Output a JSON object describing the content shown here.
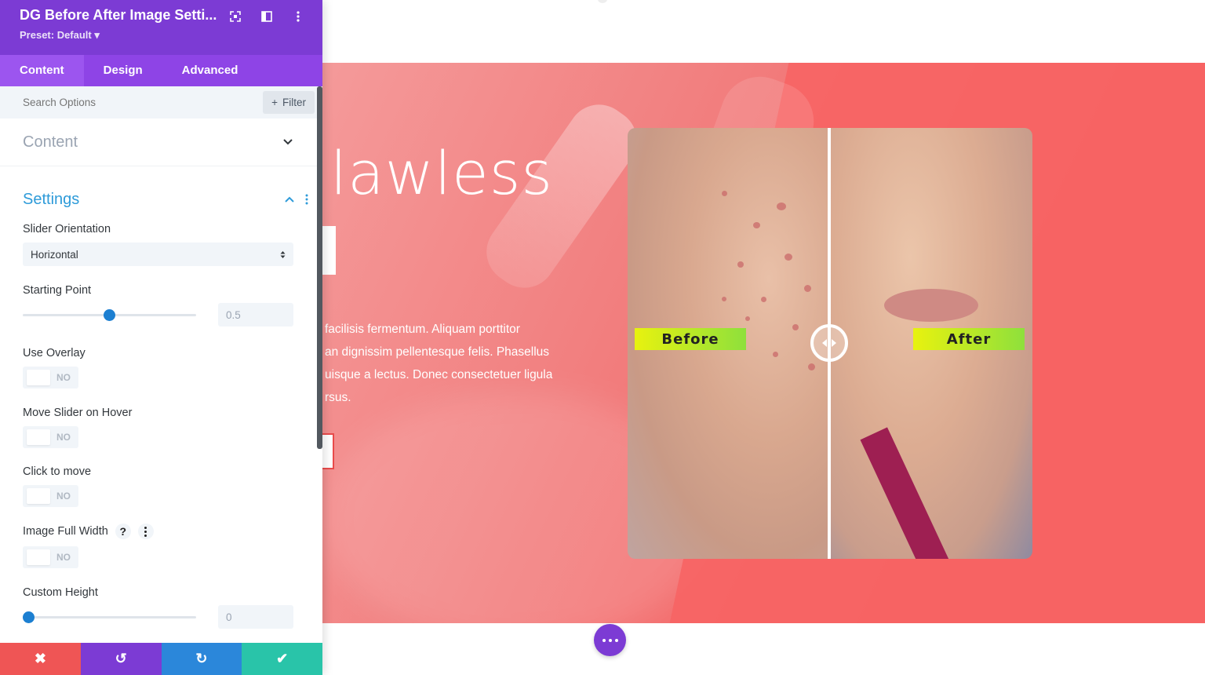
{
  "panel": {
    "title": "DG Before After Image Setti...",
    "preset": "Preset: Default ▾",
    "tabs": [
      {
        "label": "Content"
      },
      {
        "label": "Design"
      },
      {
        "label": "Advanced"
      }
    ],
    "search_placeholder": "Search Options",
    "filter_label": "Filter",
    "sections": {
      "content": "Content",
      "settings": "Settings"
    },
    "options": {
      "slider_orientation": {
        "label": "Slider Orientation",
        "value": "Horizontal"
      },
      "starting_point": {
        "label": "Starting Point",
        "value": "0.5",
        "fraction": 0.5
      },
      "use_overlay": {
        "label": "Use Overlay",
        "value": "NO"
      },
      "move_on_hover": {
        "label": "Move Slider on Hover",
        "value": "NO"
      },
      "click_to_move": {
        "label": "Click to move",
        "value": "NO"
      },
      "image_full_width": {
        "label": "Image Full Width",
        "value": "NO",
        "help": "?"
      },
      "custom_height": {
        "label": "Custom Height",
        "value": "0",
        "fraction": 0
      }
    },
    "footer": {
      "close": "✖",
      "undo": "↺",
      "redo": "↻",
      "save": "✔"
    }
  },
  "canvas": {
    "hero_title": "lawless",
    "hero_text": "facilisis fermentum. Aliquam porttitor\nan dignissim pellentesque felis. Phasellus\nuisque a lectus. Donec consectetuer ligula\nrsus.",
    "before_label": "Before",
    "after_label": "After"
  },
  "colors": {
    "panel_header": "#7c3bd4",
    "tabs_bar": "#8e44e6",
    "settings_accent": "#2e9bd9",
    "hero_bg": "#f46262",
    "label_gradient_start": "#e8f20f",
    "label_gradient_end": "#8ee03c"
  },
  "icons": {
    "header": [
      "fullscreen-icon",
      "split-view-icon",
      "more-vertical-icon"
    ],
    "footer": [
      "close-icon",
      "undo-icon",
      "redo-icon",
      "check-icon"
    ]
  }
}
